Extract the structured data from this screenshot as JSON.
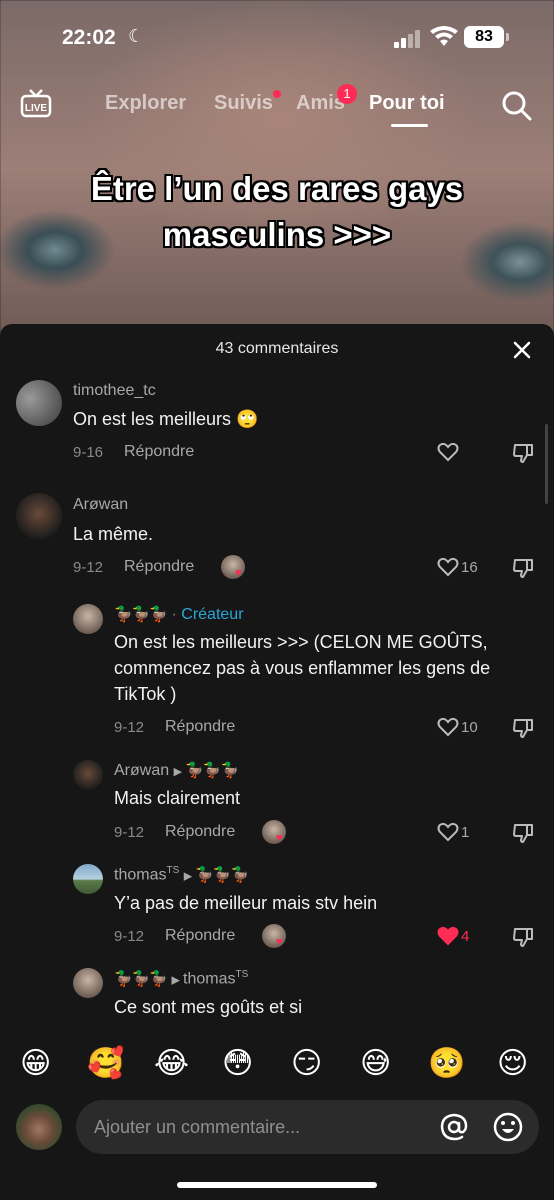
{
  "status_bar": {
    "time": "22:02",
    "battery": "83"
  },
  "nav": {
    "tabs": [
      {
        "label": "Explorer"
      },
      {
        "label": "Suivis"
      },
      {
        "label": "Amis",
        "badge": "1"
      },
      {
        "label": "Pour toi",
        "active": true
      }
    ],
    "live_label": "LIVE"
  },
  "video": {
    "overlay_line1": "Être l’un des rares gays",
    "overlay_line2": "masculins >>>"
  },
  "comments_sheet": {
    "title": "43 commentaires",
    "reply_label": "Répondre",
    "comments": [
      {
        "username": "timothee_tc",
        "text": "On est les meilleurs 🙄",
        "date": "9-16",
        "likes": ""
      },
      {
        "username": "Arøwan",
        "text": "La même.",
        "date": "9-12",
        "likes": "16"
      },
      {
        "username": "🦆🦆🦆",
        "tag": "Créateur",
        "text_line1": "On est les meilleurs >>> (CELON ME GOÛTS,",
        "text_line2": "commencez pas à vous enflammer les gens de",
        "text_line3": "TikTok )",
        "date": "9-12",
        "likes": "10"
      },
      {
        "username": "Arøwan",
        "reply_to": "🦆🦆🦆",
        "text": "Mais clairement",
        "date": "9-12",
        "likes": "1"
      },
      {
        "username": "thomas",
        "username_sup": "TS",
        "reply_to": "🦆🦆🦆",
        "text": "Y’a pas de meilleur mais stv hein",
        "date": "9-12",
        "likes": "4"
      },
      {
        "username": "🦆🦆🦆",
        "reply_to": "thomas",
        "reply_to_sup": "TS",
        "text": "Ce sont mes goûts et si"
      }
    ]
  },
  "emoji_bar": [
    "😁",
    "🥰",
    "😂",
    "😳",
    "😏",
    "😅",
    "🥺",
    "😌"
  ],
  "composer": {
    "placeholder": "Ajouter un commentaire..."
  },
  "colors": {
    "accent": "#fe2c55",
    "creator": "#2aa6d6",
    "sheet_bg": "#161616"
  }
}
